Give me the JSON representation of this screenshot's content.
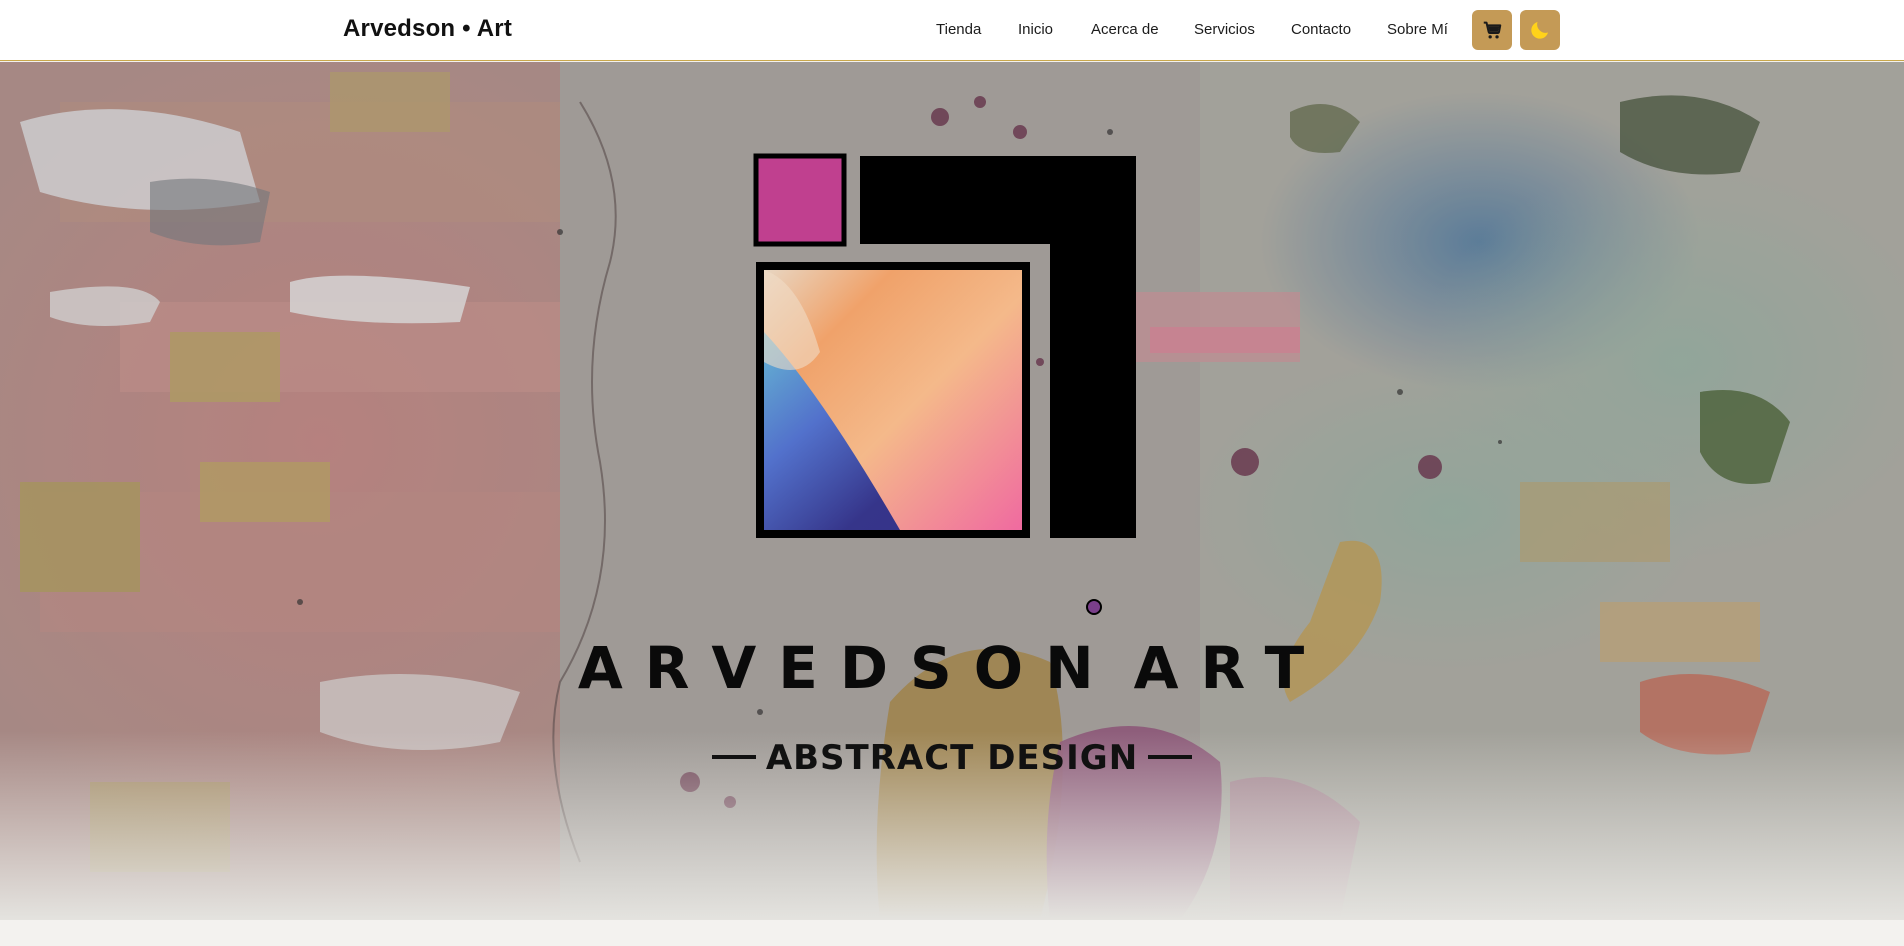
{
  "header": {
    "brand": "Arvedson • Art",
    "nav": [
      {
        "label": "Tienda"
      },
      {
        "label": "Inicio"
      },
      {
        "label": "Acerca de"
      },
      {
        "label": "Servicios"
      },
      {
        "label": "Contacto"
      },
      {
        "label": "Sobre Mí"
      }
    ],
    "cart_icon": "shopping-cart-icon",
    "theme_icon": "moon-icon"
  },
  "hero": {
    "logo_text_left": "ARVEDSON",
    "logo_text_right": "ART",
    "tagline": "ABSTRACT DESIGN"
  },
  "colors": {
    "accent": "#c49a56",
    "border": "#c9a84c",
    "logo_magenta": "#c0408f",
    "black": "#000000"
  }
}
